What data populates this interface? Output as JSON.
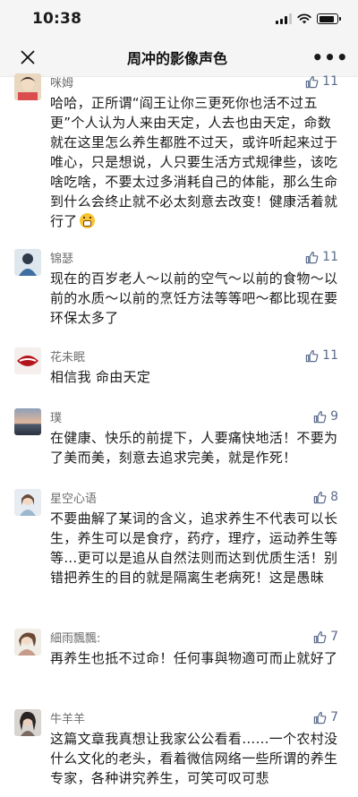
{
  "status_bar": {
    "time": "10:38"
  },
  "nav": {
    "title": "周冲的影像声色",
    "more_label": "•••"
  },
  "comments": [
    {
      "name": "咪姆",
      "likes": "11",
      "text": "哈哈，正所谓“阎王让你三更死你也活不过五更”个人认为人来由天定，人去也由天定，命数就在这里怎么养生都胜不过天，或许听起来过于唯心，只是想说，人只要生活方式规律些，该吃啥吃啥，不要太过多消耗自己的体能，那么生命到什么会终止就不必太刻意去改变！健康活着就行了"
    },
    {
      "name": "锦瑟",
      "likes": "11",
      "text": "现在的百岁老人～以前的空气～以前的食物～以前的水质～以前的烹饪方法等等吧～都比现在要环保太多了"
    },
    {
      "name": "花未眠",
      "likes": "11",
      "text": "相信我 命由天定"
    },
    {
      "name": "璞",
      "likes": "9",
      "text": "在健康、快乐的前提下，人要痛快地活！不要为了美而美，刻意去追求完美，就是作死！"
    },
    {
      "name": "星空心语",
      "likes": "8",
      "text": "不要曲解了某词的含义，追求养生不代表可以长生，养生可以是食疗，药疗，理疗，运动养生等等…更可以是追从自然法则而达到优质生活！别错把养生的目的就是隔离生老病死！这是愚昧"
    },
    {
      "name": "細雨飄飄:",
      "likes": "7",
      "text": "再养生也抵不过命！任何事與物適可而止就好了"
    },
    {
      "name": "牛羊羊",
      "likes": "7",
      "text": "这篇文章我真想让我家公公看看……一个农村没什么文化的老头，看着微信网络一些所谓的养生专家，各种讲究养生，可笑可叹可悲"
    }
  ],
  "colors": {
    "like": "#5b6b8c",
    "name": "#6d6d6d",
    "bar_bg": "#f5f5f5"
  }
}
